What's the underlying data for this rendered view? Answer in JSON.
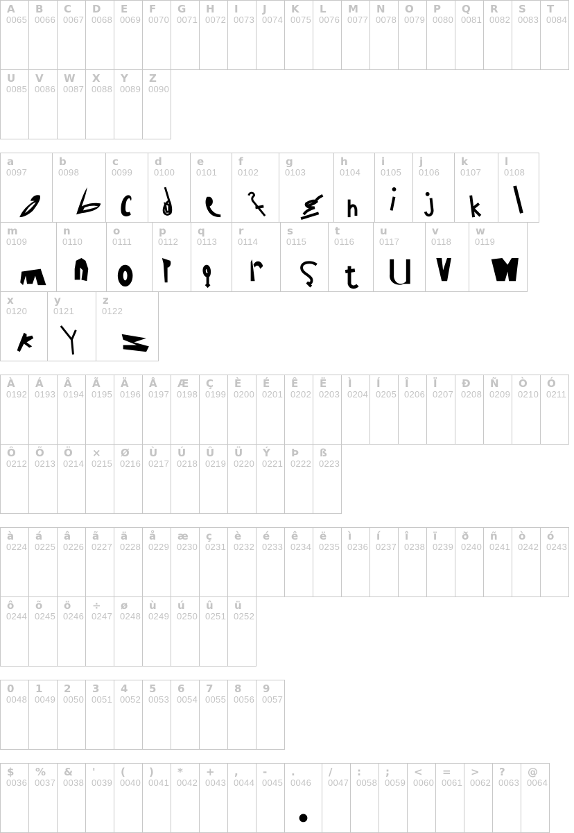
{
  "groups": [
    {
      "name": "uppercase",
      "rows": [
        {
          "cells": [
            {
              "char": "A",
              "code": "0065"
            },
            {
              "char": "B",
              "code": "0066"
            },
            {
              "char": "C",
              "code": "0067"
            },
            {
              "char": "D",
              "code": "0068"
            },
            {
              "char": "E",
              "code": "0069"
            },
            {
              "char": "F",
              "code": "0070"
            },
            {
              "char": "G",
              "code": "0071"
            },
            {
              "char": "H",
              "code": "0072"
            },
            {
              "char": "I",
              "code": "0073"
            },
            {
              "char": "J",
              "code": "0074"
            },
            {
              "char": "K",
              "code": "0075"
            },
            {
              "char": "L",
              "code": "0076"
            },
            {
              "char": "M",
              "code": "0077"
            },
            {
              "char": "N",
              "code": "0078"
            },
            {
              "char": "O",
              "code": "0079"
            },
            {
              "char": "P",
              "code": "0080"
            },
            {
              "char": "Q",
              "code": "0081"
            },
            {
              "char": "R",
              "code": "0082"
            },
            {
              "char": "S",
              "code": "0083"
            },
            {
              "char": "T",
              "code": "0084"
            }
          ]
        },
        {
          "cells": [
            {
              "char": "U",
              "code": "0085"
            },
            {
              "char": "V",
              "code": "0086"
            },
            {
              "char": "W",
              "code": "0087"
            },
            {
              "char": "X",
              "code": "0088"
            },
            {
              "char": "Y",
              "code": "0089"
            },
            {
              "char": "Z",
              "code": "0090"
            }
          ]
        }
      ]
    },
    {
      "name": "lowercase",
      "rows": [
        {
          "cells": [
            {
              "char": "a",
              "code": "0097",
              "glyph": "a"
            },
            {
              "char": "b",
              "code": "0098",
              "glyph": "b"
            },
            {
              "char": "c",
              "code": "0099",
              "glyph": "c"
            },
            {
              "char": "d",
              "code": "0100",
              "glyph": "d"
            },
            {
              "char": "e",
              "code": "0101",
              "glyph": "e"
            },
            {
              "char": "f",
              "code": "0102",
              "glyph": "f"
            },
            {
              "char": "g",
              "code": "0103",
              "glyph": "g"
            },
            {
              "char": "h",
              "code": "0104",
              "glyph": "h"
            },
            {
              "char": "i",
              "code": "0105",
              "glyph": "i"
            },
            {
              "char": "j",
              "code": "0106",
              "glyph": "j"
            },
            {
              "char": "k",
              "code": "0107",
              "glyph": "k"
            },
            {
              "char": "l",
              "code": "0108",
              "glyph": "l"
            }
          ]
        },
        {
          "cells": [
            {
              "char": "m",
              "code": "0109",
              "glyph": "m"
            },
            {
              "char": "n",
              "code": "0110",
              "glyph": "n"
            },
            {
              "char": "o",
              "code": "0111",
              "glyph": "o"
            },
            {
              "char": "p",
              "code": "0112",
              "glyph": "p"
            },
            {
              "char": "q",
              "code": "0113",
              "glyph": "q"
            },
            {
              "char": "r",
              "code": "0114",
              "glyph": "r"
            },
            {
              "char": "s",
              "code": "0115",
              "glyph": "s"
            },
            {
              "char": "t",
              "code": "0116",
              "glyph": "t"
            },
            {
              "char": "u",
              "code": "0117",
              "glyph": "u"
            },
            {
              "char": "v",
              "code": "0118",
              "glyph": "v"
            },
            {
              "char": "w",
              "code": "0119",
              "glyph": "w"
            }
          ]
        },
        {
          "cells": [
            {
              "char": "x",
              "code": "0120",
              "glyph": "x"
            },
            {
              "char": "y",
              "code": "0121",
              "glyph": "y"
            },
            {
              "char": "z",
              "code": "0122",
              "glyph": "z"
            }
          ]
        }
      ]
    },
    {
      "name": "accented-uppercase",
      "rows": [
        {
          "cells": [
            {
              "char": "À",
              "code": "0192"
            },
            {
              "char": "Á",
              "code": "0193"
            },
            {
              "char": "Â",
              "code": "0194"
            },
            {
              "char": "Ã",
              "code": "0195"
            },
            {
              "char": "Ä",
              "code": "0196"
            },
            {
              "char": "Å",
              "code": "0197"
            },
            {
              "char": "Æ",
              "code": "0198"
            },
            {
              "char": "Ç",
              "code": "0199"
            },
            {
              "char": "È",
              "code": "0200"
            },
            {
              "char": "É",
              "code": "0201"
            },
            {
              "char": "Ê",
              "code": "0202"
            },
            {
              "char": "Ë",
              "code": "0203"
            },
            {
              "char": "Ì",
              "code": "0204"
            },
            {
              "char": "Í",
              "code": "0205"
            },
            {
              "char": "Î",
              "code": "0206"
            },
            {
              "char": "Ï",
              "code": "0207"
            },
            {
              "char": "Ð",
              "code": "0208"
            },
            {
              "char": "Ñ",
              "code": "0209"
            },
            {
              "char": "Ò",
              "code": "0210"
            },
            {
              "char": "Ó",
              "code": "0211"
            }
          ]
        },
        {
          "cells": [
            {
              "char": "Ô",
              "code": "0212"
            },
            {
              "char": "Õ",
              "code": "0213"
            },
            {
              "char": "Ö",
              "code": "0214"
            },
            {
              "char": "×",
              "code": "0215"
            },
            {
              "char": "Ø",
              "code": "0216"
            },
            {
              "char": "Ù",
              "code": "0217"
            },
            {
              "char": "Ú",
              "code": "0218"
            },
            {
              "char": "Û",
              "code": "0219"
            },
            {
              "char": "Ü",
              "code": "0220"
            },
            {
              "char": "Ý",
              "code": "0221"
            },
            {
              "char": "Þ",
              "code": "0222"
            },
            {
              "char": "ß",
              "code": "0223"
            }
          ]
        }
      ]
    },
    {
      "name": "accented-lowercase",
      "rows": [
        {
          "cells": [
            {
              "char": "à",
              "code": "0224"
            },
            {
              "char": "á",
              "code": "0225"
            },
            {
              "char": "â",
              "code": "0226"
            },
            {
              "char": "ã",
              "code": "0227"
            },
            {
              "char": "ä",
              "code": "0228"
            },
            {
              "char": "å",
              "code": "0229"
            },
            {
              "char": "æ",
              "code": "0230"
            },
            {
              "char": "ç",
              "code": "0231"
            },
            {
              "char": "è",
              "code": "0232"
            },
            {
              "char": "é",
              "code": "0233"
            },
            {
              "char": "ê",
              "code": "0234"
            },
            {
              "char": "ë",
              "code": "0235"
            },
            {
              "char": "ì",
              "code": "0236"
            },
            {
              "char": "í",
              "code": "0237"
            },
            {
              "char": "î",
              "code": "0238"
            },
            {
              "char": "ï",
              "code": "0239"
            },
            {
              "char": "ð",
              "code": "0240"
            },
            {
              "char": "ñ",
              "code": "0241"
            },
            {
              "char": "ò",
              "code": "0242"
            },
            {
              "char": "ó",
              "code": "0243"
            }
          ]
        },
        {
          "cells": [
            {
              "char": "ô",
              "code": "0244"
            },
            {
              "char": "õ",
              "code": "0245"
            },
            {
              "char": "ö",
              "code": "0246"
            },
            {
              "char": "÷",
              "code": "0247"
            },
            {
              "char": "ø",
              "code": "0248"
            },
            {
              "char": "ù",
              "code": "0249"
            },
            {
              "char": "ú",
              "code": "0250"
            },
            {
              "char": "û",
              "code": "0251"
            },
            {
              "char": "ü",
              "code": "0252"
            }
          ]
        }
      ]
    },
    {
      "name": "digits",
      "rows": [
        {
          "cells": [
            {
              "char": "0",
              "code": "0048"
            },
            {
              "char": "1",
              "code": "0049"
            },
            {
              "char": "2",
              "code": "0050"
            },
            {
              "char": "3",
              "code": "0051"
            },
            {
              "char": "4",
              "code": "0052"
            },
            {
              "char": "5",
              "code": "0053"
            },
            {
              "char": "6",
              "code": "0054"
            },
            {
              "char": "7",
              "code": "0055"
            },
            {
              "char": "8",
              "code": "0056"
            },
            {
              "char": "9",
              "code": "0057"
            }
          ]
        }
      ]
    },
    {
      "name": "punctuation",
      "rows": [
        {
          "cells": [
            {
              "char": "$",
              "code": "0036"
            },
            {
              "char": "%",
              "code": "0037"
            },
            {
              "char": "&",
              "code": "0038"
            },
            {
              "char": "'",
              "code": "0039"
            },
            {
              "char": "(",
              "code": "0040"
            },
            {
              "char": ")",
              "code": "0041"
            },
            {
              "char": "*",
              "code": "0042"
            },
            {
              "char": "+",
              "code": "0043"
            },
            {
              "char": ",",
              "code": "0044"
            },
            {
              "char": "-",
              "code": "0045"
            },
            {
              "char": ".",
              "code": "0046",
              "glyph": "period"
            },
            {
              "char": "/",
              "code": "0047"
            },
            {
              "char": ":",
              "code": "0058"
            },
            {
              "char": ";",
              "code": "0059"
            },
            {
              "char": "<",
              "code": "0060"
            },
            {
              "char": "=",
              "code": "0061"
            },
            {
              "char": ">",
              "code": "0062"
            },
            {
              "char": "?",
              "code": "0063"
            },
            {
              "char": "@",
              "code": "0064"
            }
          ]
        }
      ]
    }
  ]
}
